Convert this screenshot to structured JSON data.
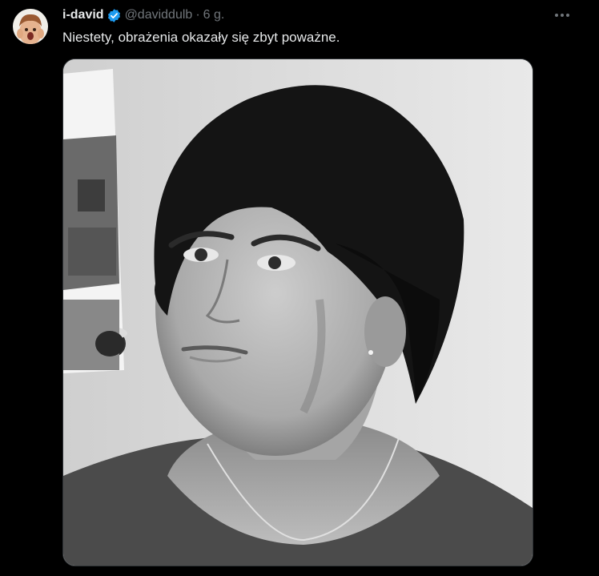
{
  "tweet": {
    "display_name": "i-david",
    "handle": "@daviddulb",
    "separator": "·",
    "timestamp": "6 g.",
    "text": "Niestety, obrażenia okazały się zbyt poważne.",
    "verified": true,
    "icons": {
      "avatar": "avatar-photo",
      "verified": "verified-badge-icon",
      "more": "more-options-icon"
    },
    "media": {
      "kind": "photo",
      "description_color": "grayscale"
    }
  },
  "colors": {
    "background": "#000000",
    "text_primary": "#e7e9ea",
    "text_secondary": "#71767b",
    "verified": "#1d9bf0",
    "border": "#2f3336"
  }
}
